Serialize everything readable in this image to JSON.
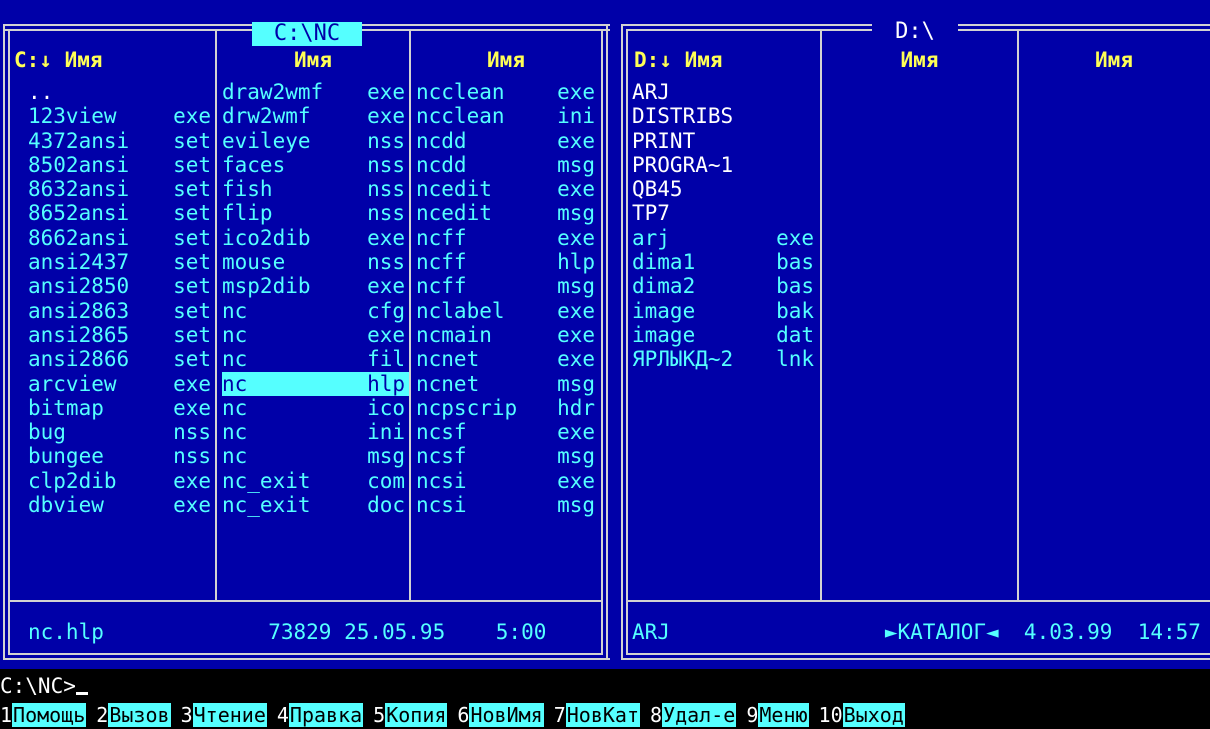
{
  "left_panel": {
    "title": "C:\\NC",
    "headers": [
      "C:↓ Имя",
      "Имя",
      "Имя"
    ],
    "columns": [
      [
        {
          "name": "..",
          "ext": "",
          "type": "dir"
        },
        {
          "name": "123view",
          "ext": "exe"
        },
        {
          "name": "4372ansi",
          "ext": "set"
        },
        {
          "name": "8502ansi",
          "ext": "set"
        },
        {
          "name": "8632ansi",
          "ext": "set"
        },
        {
          "name": "8652ansi",
          "ext": "set"
        },
        {
          "name": "8662ansi",
          "ext": "set"
        },
        {
          "name": "ansi2437",
          "ext": "set"
        },
        {
          "name": "ansi2850",
          "ext": "set"
        },
        {
          "name": "ansi2863",
          "ext": "set"
        },
        {
          "name": "ansi2865",
          "ext": "set"
        },
        {
          "name": "ansi2866",
          "ext": "set"
        },
        {
          "name": "arcview",
          "ext": "exe"
        },
        {
          "name": "bitmap",
          "ext": "exe"
        },
        {
          "name": "bug",
          "ext": "nss"
        },
        {
          "name": "bungee",
          "ext": "nss"
        },
        {
          "name": "clp2dib",
          "ext": "exe"
        },
        {
          "name": "dbview",
          "ext": "exe"
        }
      ],
      [
        {
          "name": "draw2wmf",
          "ext": "exe"
        },
        {
          "name": "drw2wmf",
          "ext": "exe"
        },
        {
          "name": "evileye",
          "ext": "nss"
        },
        {
          "name": "faces",
          "ext": "nss"
        },
        {
          "name": "fish",
          "ext": "nss"
        },
        {
          "name": "flip",
          "ext": "nss"
        },
        {
          "name": "ico2dib",
          "ext": "exe"
        },
        {
          "name": "mouse",
          "ext": "nss"
        },
        {
          "name": "msp2dib",
          "ext": "exe"
        },
        {
          "name": "nc",
          "ext": "cfg"
        },
        {
          "name": "nc",
          "ext": "exe"
        },
        {
          "name": "nc",
          "ext": "fil"
        },
        {
          "name": "nc",
          "ext": "hlp",
          "selected": true
        },
        {
          "name": "nc",
          "ext": "ico"
        },
        {
          "name": "nc",
          "ext": "ini"
        },
        {
          "name": "nc",
          "ext": "msg"
        },
        {
          "name": "nc_exit",
          "ext": "com"
        },
        {
          "name": "nc_exit",
          "ext": "doc"
        }
      ],
      [
        {
          "name": "ncclean",
          "ext": "exe"
        },
        {
          "name": "ncclean",
          "ext": "ini"
        },
        {
          "name": "ncdd",
          "ext": "exe"
        },
        {
          "name": "ncdd",
          "ext": "msg"
        },
        {
          "name": "ncedit",
          "ext": "exe"
        },
        {
          "name": "ncedit",
          "ext": "msg"
        },
        {
          "name": "ncff",
          "ext": "exe"
        },
        {
          "name": "ncff",
          "ext": "hlp"
        },
        {
          "name": "ncff",
          "ext": "msg"
        },
        {
          "name": "nclabel",
          "ext": "exe"
        },
        {
          "name": "ncmain",
          "ext": "exe"
        },
        {
          "name": "ncnet",
          "ext": "exe"
        },
        {
          "name": "ncnet",
          "ext": "msg"
        },
        {
          "name": "ncpscrip",
          "ext": "hdr"
        },
        {
          "name": "ncsf",
          "ext": "exe"
        },
        {
          "name": "ncsf",
          "ext": "msg"
        },
        {
          "name": "ncsi",
          "ext": "exe"
        },
        {
          "name": "ncsi",
          "ext": "msg"
        }
      ]
    ],
    "status": "nc.hlp             73829 25.05.95    5:00"
  },
  "right_panel": {
    "title": "D:\\",
    "headers": [
      "D:↓ Имя",
      "Имя",
      "Имя"
    ],
    "columns": [
      [
        {
          "name": "ARJ",
          "ext": "",
          "type": "dir"
        },
        {
          "name": "DISTRIBS",
          "ext": "",
          "type": "dir"
        },
        {
          "name": "PRINT",
          "ext": "",
          "type": "dir"
        },
        {
          "name": "PROGRA~1",
          "ext": "",
          "type": "dir"
        },
        {
          "name": "QB45",
          "ext": "",
          "type": "dir"
        },
        {
          "name": "TP7",
          "ext": "",
          "type": "dir"
        },
        {
          "name": "arj",
          "ext": "exe"
        },
        {
          "name": "dima1",
          "ext": "bas"
        },
        {
          "name": "dima2",
          "ext": "bas"
        },
        {
          "name": "image",
          "ext": "bak"
        },
        {
          "name": "image",
          "ext": "dat"
        },
        {
          "name": "ЯРЛЫКД~2",
          "ext": "lnk"
        }
      ],
      [],
      []
    ],
    "status": "ARJ                 ►КАТАЛОГ◄  4.03.99  14:57"
  },
  "command_line": "C:\\NC>",
  "function_keys": [
    {
      "num": "1",
      "label": "Помощь"
    },
    {
      "num": "2",
      "label": "Вызов "
    },
    {
      "num": "3",
      "label": "Чтение"
    },
    {
      "num": "4",
      "label": "Правка"
    },
    {
      "num": "5",
      "label": "Копия "
    },
    {
      "num": "6",
      "label": "НовИмя"
    },
    {
      "num": "7",
      "label": "НовКат"
    },
    {
      "num": "8",
      "label": "Удал-е"
    },
    {
      "num": "9",
      "label": "Меню  "
    },
    {
      "num": "10",
      "label": "Выход"
    }
  ],
  "colors": {
    "panel_bg": "#0000a8",
    "file_text": "#55ffff",
    "header_text": "#ffff55",
    "selection_bg": "#55ffff",
    "frame": "#d2d2d2"
  }
}
